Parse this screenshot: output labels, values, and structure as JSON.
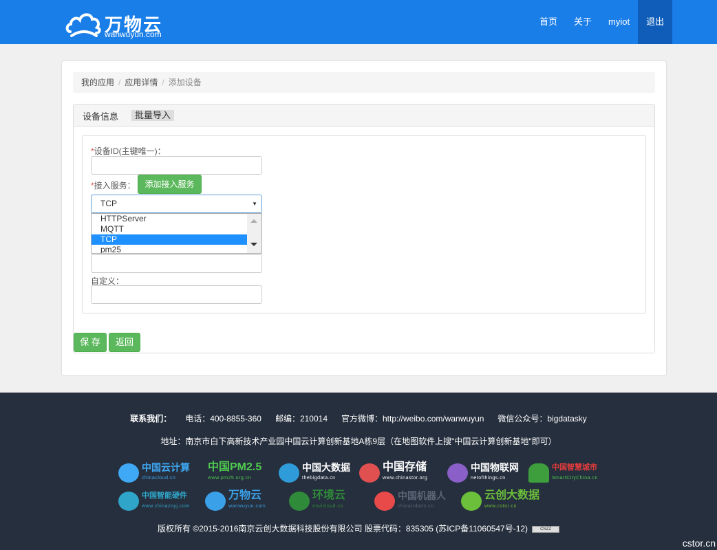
{
  "header": {
    "logo_text": "万物云",
    "logo_sub": "wanwuyun.com",
    "nav": [
      {
        "label": "首页",
        "active": false
      },
      {
        "label": "关于",
        "active": false
      },
      {
        "label": "myiot",
        "active": false
      },
      {
        "label": "退出",
        "active": true
      }
    ]
  },
  "breadcrumb": {
    "items": [
      "我的应用",
      "应用详情"
    ],
    "current": "添加设备"
  },
  "tabs": {
    "tab1": "设备信息",
    "tab2": "批量导入"
  },
  "form": {
    "device_id_label": "设备ID(主键唯一)：",
    "device_id_value": "",
    "service_label": "接入服务：",
    "add_service_button": "添加接入服务",
    "service_selected": "TCP",
    "service_options": [
      "HTTPServer",
      "MQTT",
      "TCP",
      "pm25"
    ],
    "custom_label": "自定义：",
    "custom_value": "",
    "required_mark": "*"
  },
  "actions": {
    "save": "保 存",
    "back": "返回"
  },
  "footer": {
    "contact_title": "联系我们：",
    "phone": "电话：400-8855-360",
    "postcode": "邮编：210014",
    "weibo": "官方微博：http://weibo.com/wanwuyun",
    "wechat": "微信公众号：bigdatasky",
    "address": "地址：南京市白下高新技术产业园中国云计算创新基地A栋9层（在地图软件上搜\"中国云计算创新基地\"即可）",
    "partners_row1": [
      {
        "name": "中国云计算",
        "sub": "chinacloud.cn",
        "color": "#3fa9f5"
      },
      {
        "name": "中国PM2.5",
        "sub": "www.pm25.org.cn",
        "color": "#4ec94e"
      },
      {
        "name": "中国大数据",
        "sub": "thebigdata.cn",
        "color": "#2f9bd8"
      },
      {
        "name": "中国存储",
        "sub": "www.chinastor.org",
        "color": "#e05050"
      },
      {
        "name": "中国物联网",
        "sub": "netofthings.cn",
        "color": "#8a5fc7"
      },
      {
        "name": "中国智慧城市",
        "sub": "SmartCityChina.cn",
        "color": "#e03c3c"
      }
    ],
    "partners_row2": [
      {
        "name": "中国智能硬件",
        "sub": "www.chinaznyj.com",
        "color": "#2fa5c9"
      },
      {
        "name": "万物云",
        "sub": "wanwuyun.com",
        "color": "#3aa0e8"
      },
      {
        "name": "环境云",
        "sub": "envicloud.cn",
        "color": "#2f8a3a"
      },
      {
        "name": "中国机器人",
        "sub": "chinarobots.cn",
        "color": "#e84a4a"
      },
      {
        "name": "云创大数据",
        "sub": "www.cstor.cn",
        "color": "#6bbf3a"
      }
    ],
    "copyright": "版权所有 ©2015-2016南京云创大数据科技股份有限公司 股票代码：835305 (苏ICP备11060547号-12)",
    "cnzz": "CNZZ"
  },
  "watermark": "cstor.cn",
  "colors": {
    "header_bg": "#1a7ee8",
    "nav_active": "#0f5db8",
    "green": "#5cb85c",
    "footer_bg": "#262f3d",
    "select_highlight": "#1e90ff"
  }
}
